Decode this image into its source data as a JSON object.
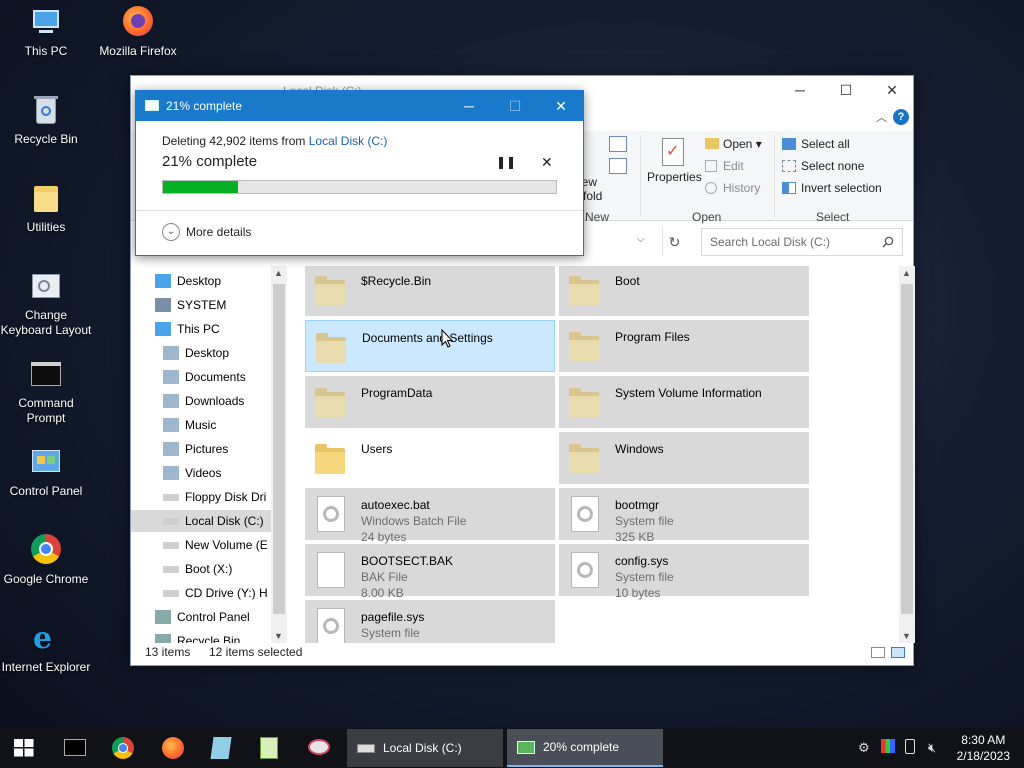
{
  "desktop": {
    "icons": [
      {
        "label": "This PC",
        "icon": "this-pc-icon"
      },
      {
        "label": "Mozilla Firefox",
        "icon": "firefox-icon"
      },
      {
        "label": "Recycle Bin",
        "icon": "recycle-bin-icon"
      },
      {
        "label": "Utilities",
        "icon": "folder-icon"
      },
      {
        "label": "Change Keyboard Layout",
        "icon": "keyboard-icon"
      },
      {
        "label": "Command Prompt",
        "icon": "cmd-icon"
      },
      {
        "label": "Control Panel",
        "icon": "control-panel-icon"
      },
      {
        "label": "Google Chrome",
        "icon": "chrome-icon"
      },
      {
        "label": "Internet Explorer",
        "icon": "ie-icon"
      }
    ]
  },
  "explorer": {
    "title": "Local Disk (C:)",
    "ribbon": {
      "new_folder_label": "New folder",
      "new_group": "New",
      "properties": "Properties",
      "open": "Open",
      "edit": "Edit",
      "history": "History",
      "open_group": "Open",
      "select_all": "Select all",
      "select_none": "Select none",
      "invert_selection": "Invert selection",
      "select_group": "Select"
    },
    "search_placeholder": "Search Local Disk (C:)",
    "nav": [
      {
        "label": "Desktop",
        "indent": 0
      },
      {
        "label": "SYSTEM",
        "indent": 0
      },
      {
        "label": "This PC",
        "indent": 0
      },
      {
        "label": "Desktop",
        "indent": 1
      },
      {
        "label": "Documents",
        "indent": 1
      },
      {
        "label": "Downloads",
        "indent": 1
      },
      {
        "label": "Music",
        "indent": 1
      },
      {
        "label": "Pictures",
        "indent": 1
      },
      {
        "label": "Videos",
        "indent": 1
      },
      {
        "label": "Floppy Disk Dri",
        "indent": 1
      },
      {
        "label": "Local Disk (C:)",
        "indent": 1,
        "selected": true
      },
      {
        "label": "New Volume (E",
        "indent": 1
      },
      {
        "label": "Boot (X:)",
        "indent": 1
      },
      {
        "label": "CD Drive (Y:) H",
        "indent": 1
      },
      {
        "label": "Control Panel",
        "indent": 0
      },
      {
        "label": "Recycle Bin",
        "indent": 0
      }
    ],
    "items": [
      {
        "name": "$Recycle.Bin",
        "type": "folder",
        "state": "selected"
      },
      {
        "name": "Boot",
        "type": "folder",
        "state": "selected"
      },
      {
        "name": "Documents and Settings",
        "type": "folder",
        "state": "hover"
      },
      {
        "name": "Program Files",
        "type": "folder",
        "state": "selected"
      },
      {
        "name": "ProgramData",
        "type": "folder",
        "state": "selected"
      },
      {
        "name": "System Volume Information",
        "type": "folder",
        "state": "selected"
      },
      {
        "name": "Users",
        "type": "folder",
        "state": "plain"
      },
      {
        "name": "Windows",
        "type": "folder",
        "state": "selected"
      },
      {
        "name": "autoexec.bat",
        "type": "file",
        "subtype": "Windows Batch File",
        "size": "24 bytes",
        "state": "selected"
      },
      {
        "name": "bootmgr",
        "type": "file",
        "subtype": "System file",
        "size": "325 KB",
        "state": "selected"
      },
      {
        "name": "BOOTSECT.BAK",
        "type": "file",
        "subtype": "BAK File",
        "size": "8.00 KB",
        "state": "selected"
      },
      {
        "name": "config.sys",
        "type": "file",
        "subtype": "System file",
        "size": "10 bytes",
        "state": "selected"
      },
      {
        "name": "pagefile.sys",
        "type": "file",
        "subtype": "System file",
        "size": "",
        "state": "selected"
      }
    ],
    "status_count": "13 items",
    "status_selected": "12 items selected"
  },
  "dialog": {
    "title": "21% complete",
    "line_prefix": "Deleting 42,902 items from ",
    "line_link": "Local Disk (C:)",
    "percent_text": "21% complete",
    "progress": 0.19,
    "more_details": "More details"
  },
  "taskbar": {
    "window1": "Local Disk (C:)",
    "window2": "20% complete",
    "time": "8:30 AM",
    "date": "2/18/2023"
  }
}
